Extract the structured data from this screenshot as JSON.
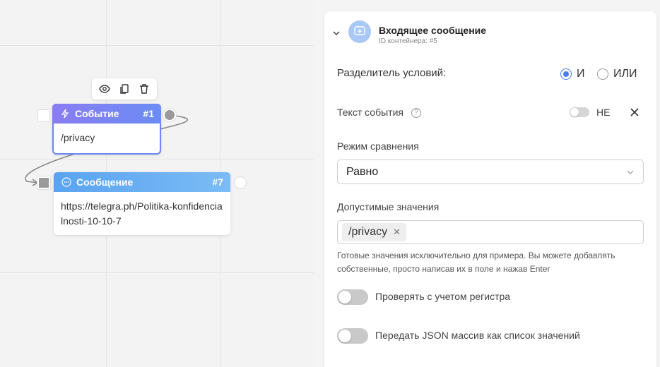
{
  "canvas": {
    "toolbar": {
      "icons": [
        "eye-icon",
        "copy-icon",
        "trash-icon"
      ]
    },
    "nodes": [
      {
        "title": "Событие",
        "id": "#1",
        "body": "/privacy",
        "icon": "lightning-icon",
        "color": "#7b86f3"
      },
      {
        "title": "Сообщение",
        "id": "#7",
        "body": "https://telegra.ph/Politika-konfidencialnosti-10-10-7",
        "icon": "chat-icon",
        "color": "#5aa3f0"
      }
    ]
  },
  "panel": {
    "header": {
      "title": "Входящее сообщение",
      "subtitle": "ID контейнера: #5",
      "icon": "incoming-message-icon"
    },
    "separator": {
      "label": "Разделитель условий:",
      "options": [
        "И",
        "ИЛИ"
      ],
      "selected": "И"
    },
    "event_text": {
      "label": "Текст события",
      "help": "?",
      "not_label": "НЕ",
      "not_enabled": false
    },
    "compare_mode": {
      "label": "Режим сравнения",
      "value": "Равно"
    },
    "allowed_values": {
      "label": "Допустимые значения",
      "tags": [
        "/privacy"
      ],
      "hint": "Готовые значения исключительно для примера. Вы можете добавлять собственные, просто написав их в поле и нажав Enter"
    },
    "case_sensitive": {
      "label": "Проверять с учетом регистра",
      "enabled": false
    },
    "json_array": {
      "label": "Передать JSON массив как список значений",
      "enabled": false
    }
  },
  "colors": {
    "accent": "#4a7ef0",
    "event_header": "#7b86f3",
    "message_header": "#5aa3f0"
  }
}
